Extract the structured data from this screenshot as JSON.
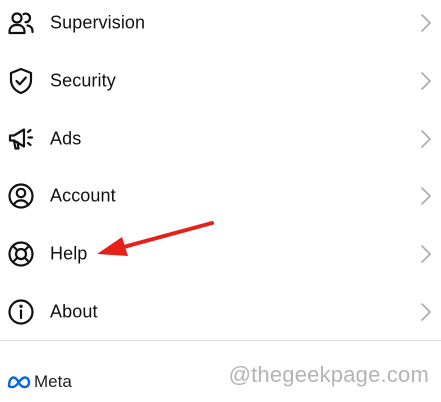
{
  "menu": {
    "items": [
      {
        "label": "Supervision",
        "icon": "supervision-icon"
      },
      {
        "label": "Security",
        "icon": "shield-icon"
      },
      {
        "label": "Ads",
        "icon": "megaphone-icon"
      },
      {
        "label": "Account",
        "icon": "account-icon"
      },
      {
        "label": "Help",
        "icon": "lifebuoy-icon"
      },
      {
        "label": "About",
        "icon": "info-icon"
      }
    ]
  },
  "footer": {
    "brand": "Meta",
    "brand_color": "#0668e1"
  },
  "watermark": "@thegeekpage.com",
  "annotation": {
    "arrow_color": "#e8201a"
  }
}
